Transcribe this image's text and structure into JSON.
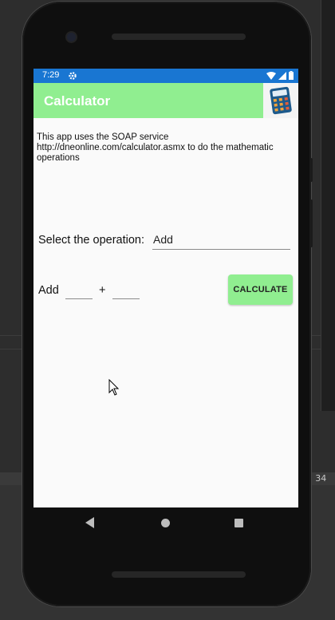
{
  "status_bar": {
    "time": "7:29",
    "icons": [
      "gear-icon",
      "wifi-icon",
      "signal-icon",
      "battery-icon"
    ]
  },
  "toolbar": {
    "title": "Calculator",
    "app_icon": "calculator-icon"
  },
  "description": "This app uses the SOAP service http://dneonline.com/calculator.asmx to do the mathematic operations",
  "operation": {
    "label": "Select the operation:",
    "selected": "Add"
  },
  "calc_row": {
    "op_label": "Add",
    "operator_symbol": "+",
    "first_value": "",
    "second_value": "",
    "button_label": "CALCULATE"
  },
  "ide": {
    "status_fragment": ": 34"
  },
  "colors": {
    "accent": "#90ee90",
    "status_bar": "#1976d2"
  },
  "nav": {
    "icons": [
      "back-icon",
      "home-icon",
      "recents-icon"
    ]
  }
}
